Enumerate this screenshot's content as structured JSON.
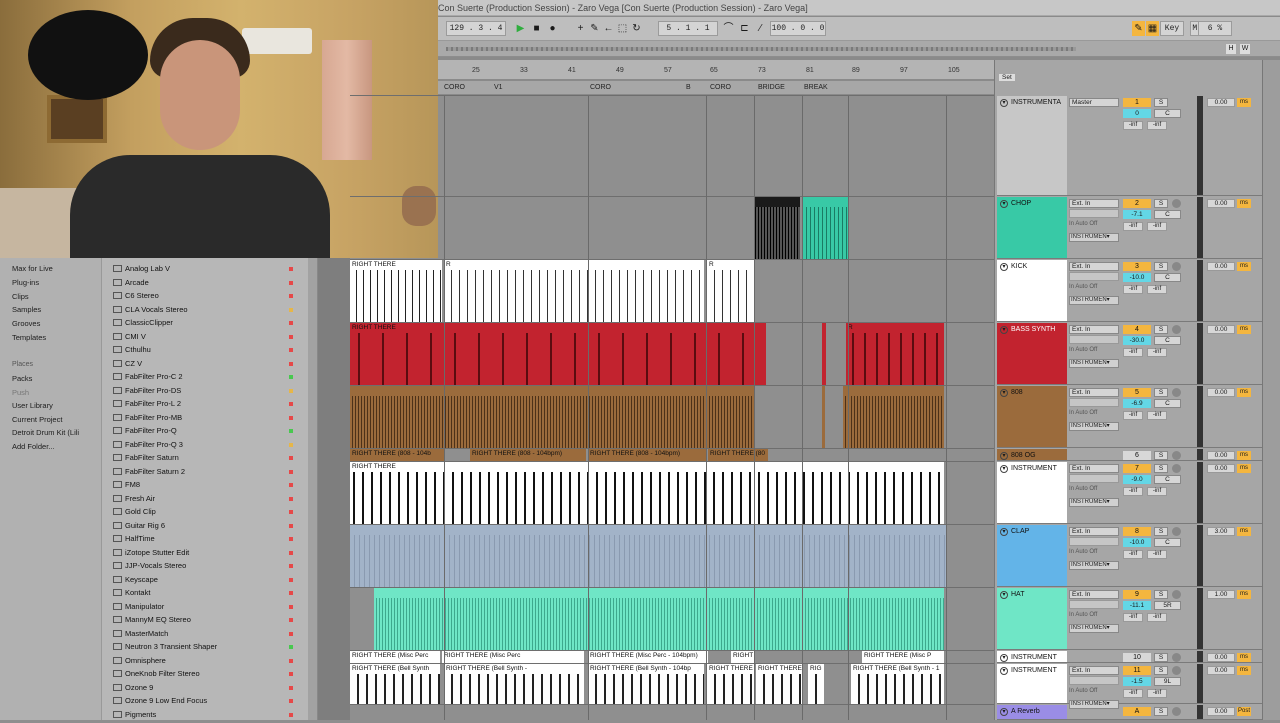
{
  "window": {
    "title": "Con Suerte (Production Session) - Zaro Vega  [Con Suerte (Production Session) - Zaro Vega]"
  },
  "transport": {
    "tempo": "129 . 3 . 4",
    "position": "5 . 1 . 1",
    "loop_length": "100 . 0 . 0",
    "key_label": "Key",
    "midi_label": "MIDI",
    "cpu": "6 %",
    "h_label": "H",
    "w_label": "W"
  },
  "colors": {
    "accent": "#f4b63f",
    "cyan": "#63d7e6",
    "teal": "#38c9a6",
    "red": "#c2232f",
    "brown": "#9b6b3c"
  },
  "ruler": {
    "bars": [
      "25",
      "33",
      "41",
      "49",
      "57",
      "65",
      "73",
      "81",
      "89",
      "97",
      "105"
    ]
  },
  "locators": [
    "CORO",
    "V1",
    "CORO",
    "B",
    "CORO",
    "BRIDGE",
    "BREAK"
  ],
  "browser": {
    "places_header": "Places",
    "categories": [
      "Max for Live",
      "Plug-ins",
      "Clips",
      "Samples",
      "Grooves",
      "Templates"
    ],
    "places": [
      "Packs",
      "Push",
      "User Library",
      "Current Project",
      "Detroit Drum Kit (Lili",
      "Add Folder..."
    ],
    "plugins": [
      "Analog Lab V",
      "Arcade",
      "C6 Stereo",
      "CLA Vocals Stereo",
      "ClassicClipper",
      "CMI V",
      "Cthulhu",
      "CZ V",
      "FabFilter Pro-C 2",
      "FabFilter Pro-DS",
      "FabFilter Pro-L 2",
      "FabFilter Pro-MB",
      "FabFilter Pro-Q",
      "FabFilter Pro-Q 3",
      "FabFilter Saturn",
      "FabFilter Saturn 2",
      "FM8",
      "Fresh Air",
      "Gold Clip",
      "Guitar Rig 6",
      "HalfTime",
      "iZotope Stutter Edit",
      "JJP-Vocals Stereo",
      "Keyscape",
      "Kontakt",
      "Manipulator",
      "MannyM EQ Stereo",
      "MasterMatch",
      "Neutron 3 Transient Shaper",
      "Omnisphere",
      "OneKnob Filter Stereo",
      "Ozone 9",
      "Ozone 9 Low End Focus",
      "Pigments"
    ]
  },
  "clips": {
    "right_there": "RIGHT THERE",
    "r": "R",
    "b808_a": "RIGHT THERE (808 - 104b",
    "b808_b": "RIGHT THERE (808 - 104bpm)",
    "b808_c": "RIGHT THERE (808 - 104bpm)",
    "b808_d": "RIGHT THERE (80",
    "perc_a": "RIGHT THERE (Misc Perc",
    "perc_b": "RIGHT THERE (Misc Perc",
    "perc_c": "RIGHT THERE",
    "perc_d": "RIGHT THERE (Misc Perc - 104bpm)",
    "perc_e": "RIGHT",
    "perc_f": "RIGHT THERE (Misc P",
    "bell_a": "RIGHT THERE (Bell Synth",
    "bell_b": "RIGHT THERE (Bell Synth -",
    "bell_c": "RIGHT THERE (Bell Synth - 104bp",
    "bell_d": "RIGHT THERE",
    "bell_e": "RIGHT THERE",
    "bell_f": "RIG",
    "bell_g": "RIGHT THERE (Bell Synth - 1"
  },
  "mixer": {
    "master": "Master",
    "ext_in": "Ext. In",
    "instrument_short": "INSTRUMEN▾",
    "in_label": "In",
    "auto_label": "Auto",
    "off_label": "Off",
    "post": "Post",
    "tracks": [
      {
        "name": "INSTRUMENTA",
        "num": "1",
        "vol": "0",
        "pan": "C",
        "db": "0.00"
      },
      {
        "name": "CHOP",
        "num": "2",
        "vol": "-7.1",
        "pan": "C",
        "db": "0.00"
      },
      {
        "name": "KICK",
        "num": "3",
        "vol": "-10.0",
        "pan": "C",
        "db": "0.00"
      },
      {
        "name": "BASS SYNTH",
        "num": "4",
        "vol": "-30.0",
        "pan": "C",
        "db": "0.00"
      },
      {
        "name": "808",
        "num": "5",
        "vol": "-6.9",
        "pan": "C",
        "db": "0.00"
      },
      {
        "name": "808 OG",
        "num": "6",
        "db": "0.00"
      },
      {
        "name": "INSTRUMENT",
        "num": "7",
        "vol": "-9.0",
        "pan": "C",
        "db": "0.00"
      },
      {
        "name": "CLAP",
        "num": "8",
        "vol": "-10.0",
        "pan": "C",
        "db": "3.00"
      },
      {
        "name": "HAT",
        "num": "9",
        "vol": "-11.1",
        "pan": "5R",
        "db": "1.00"
      },
      {
        "name": "INSTRUMENT",
        "num": "10",
        "db": "0.00"
      },
      {
        "name": "INSTRUMENT",
        "num": "11",
        "vol": "-1.5",
        "pan": "9L",
        "db": "0.00"
      },
      {
        "name": "A Reverb",
        "num": "A",
        "db": "0.00"
      }
    ],
    "inf": "-inf",
    "ms": "ms",
    "s": "S",
    "set": "Set"
  }
}
